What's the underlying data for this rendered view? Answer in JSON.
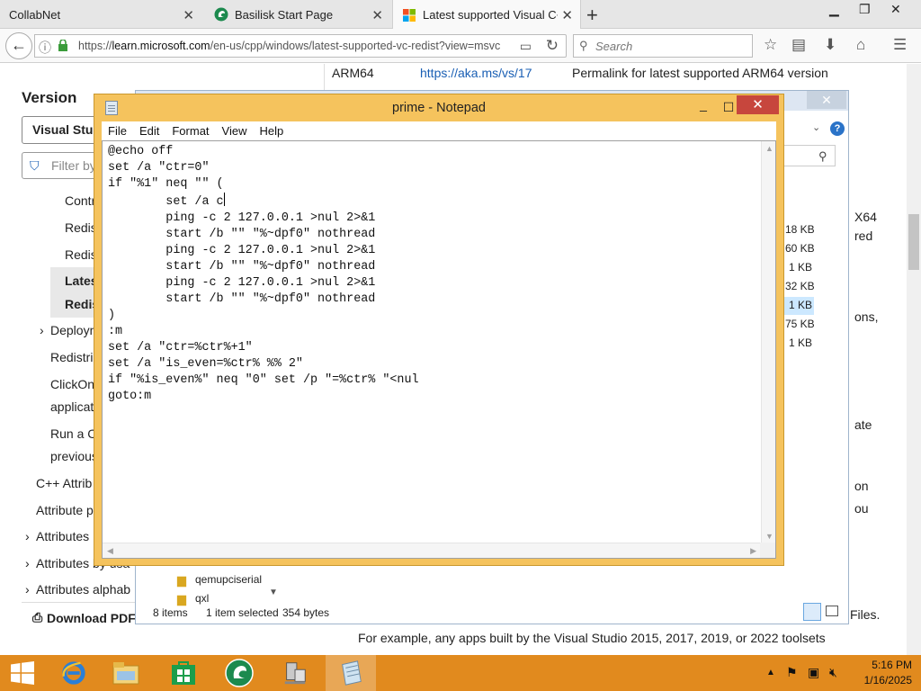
{
  "browser": {
    "tabs": [
      {
        "title": "CollabNet"
      },
      {
        "title": "Basilisk Start Page"
      },
      {
        "title": "Latest supported Visual C+"
      }
    ],
    "url": "https://learn.microsoft.com/en-us/cpp/windows/latest-supported-vc-redist?view=msvc",
    "url_domain": "learn.microsoft.com",
    "url_prefix": "https://",
    "url_suffix": "/en-us/cpp/windows/latest-supported-vc-redist?view=msvc",
    "search_placeholder": "Search"
  },
  "page": {
    "version_heading": "Version",
    "version_select": "Visual Stud",
    "filter_placeholder": "Filter by",
    "toc": [
      "Contr",
      "Redis",
      "Redis",
      "Lates",
      "Redis",
      "Deploym",
      "Redistrib",
      "ClickOn",
      "applicat",
      "Run a C",
      "previous",
      "C++ Attrib",
      "Attribute p",
      "Attributes",
      "Attributes by usa",
      "Attributes alphab"
    ],
    "download_pdf": "Download PDF",
    "table_row": {
      "arch": "ARM64",
      "link": "https://aka.ms/vs/17",
      "desc": "Permalink for latest supported ARM64 version"
    },
    "right_fragments": [
      "X64",
      "red",
      "ons,",
      "ate",
      "on",
      "ou",
      "Files."
    ],
    "footer_text": "For example, any apps built by the Visual Studio 2015, 2017, 2019, or 2022 toolsets"
  },
  "explorer": {
    "sizes": [
      "18 KB",
      "60 KB",
      "1 KB",
      "32 KB",
      "1 KB",
      "75 KB",
      "1 KB"
    ],
    "folders": [
      "qemupciserial",
      "qxl"
    ],
    "status_items": "8 items",
    "status_selected": "1 item selected",
    "status_bytes": "354 bytes"
  },
  "notepad": {
    "title": "prime - Notepad",
    "menus": [
      "File",
      "Edit",
      "Format",
      "View",
      "Help"
    ],
    "content_lines": [
      "@echo off",
      "set /a \"ctr=0\"",
      "if \"%1\" neq \"\" (",
      "        set /a c",
      "        ping -c 2 127.0.0.1 >nul 2>&1",
      "        start /b \"\" \"%~dpf0\" nothread",
      "        ping -c 2 127.0.0.1 >nul 2>&1",
      "        start /b \"\" \"%~dpf0\" nothread",
      "        ping -c 2 127.0.0.1 >nul 2>&1",
      "        start /b \"\" \"%~dpf0\" nothread",
      ")",
      ":m",
      "set /a \"ctr=%ctr%+1\"",
      "set /a \"is_even=%ctr% %% 2\"",
      "if \"%is_even%\" neq \"0\" set /p \"=%ctr% \"<nul",
      "goto:m"
    ]
  },
  "taskbar": {
    "clock_time": "5:16 PM",
    "clock_date": "1/16/2025"
  },
  "colors": {
    "taskbar": "#e18a1e",
    "notepad_frame": "#f5c35d",
    "close_button": "#c7463d",
    "link": "#1a5fb4"
  }
}
